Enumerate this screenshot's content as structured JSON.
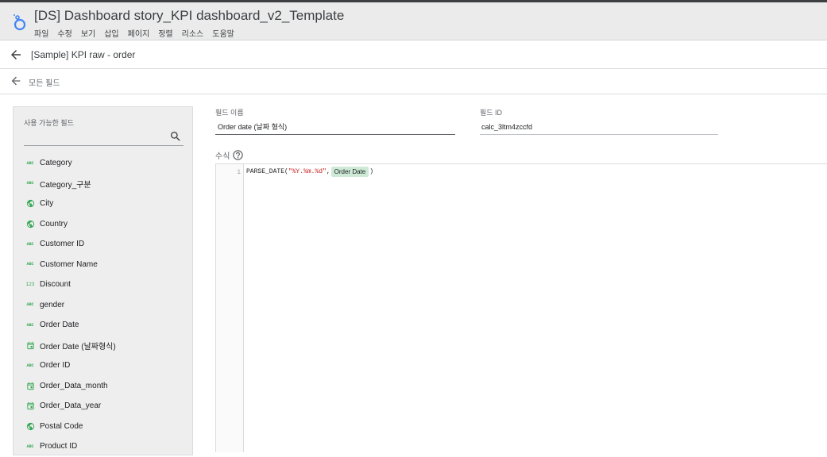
{
  "app": {
    "title": "[DS] Dashboard story_KPI dashboard_v2_Template",
    "menu": [
      "파일",
      "수정",
      "보기",
      "삽입",
      "페이지",
      "정렬",
      "리소스",
      "도움말"
    ],
    "more_dots": "....",
    "logo_icon": "looker-studio-logo-icon"
  },
  "datasource": {
    "name": "[Sample] KPI raw - order"
  },
  "nav": {
    "all_fields": "모든 필드"
  },
  "panel": {
    "label": "사용 가능한 필드",
    "search_placeholder": "",
    "fields": [
      {
        "name": "Category",
        "type": "text",
        "badge": "ABC"
      },
      {
        "name": "Category_구분",
        "type": "text",
        "badge": "ABC"
      },
      {
        "name": "City",
        "type": "geo",
        "badge": ""
      },
      {
        "name": "Country",
        "type": "geo",
        "badge": ""
      },
      {
        "name": "Customer ID",
        "type": "text",
        "badge": "ABC"
      },
      {
        "name": "Customer Name",
        "type": "text",
        "badge": "ABC"
      },
      {
        "name": "Discount",
        "type": "number",
        "badge": "123"
      },
      {
        "name": "gender",
        "type": "text",
        "badge": "ABC"
      },
      {
        "name": "Order Date",
        "type": "text",
        "badge": "ABC"
      },
      {
        "name": "Order Date (날짜형식)",
        "type": "date",
        "badge": ""
      },
      {
        "name": "Order ID",
        "type": "text",
        "badge": "ABC"
      },
      {
        "name": "Order_Data_month",
        "type": "date",
        "badge": ""
      },
      {
        "name": "Order_Data_year",
        "type": "date",
        "badge": ""
      },
      {
        "name": "Postal Code",
        "type": "geo",
        "badge": ""
      },
      {
        "name": "Product ID",
        "type": "text",
        "badge": "ABC"
      }
    ]
  },
  "form": {
    "field_name_label": "필드 이름",
    "field_name_value": "Order date (날짜 형식)",
    "field_id_label": "필드 ID",
    "field_id_value": "calc_3ltm4zccfd",
    "formula_label": "수식"
  },
  "editor": {
    "line_number": "1",
    "func": "PARSE_DATE(",
    "string_arg": "\"%Y.%m.%d\"",
    "comma": ",",
    "field_chip": "Order Date",
    "close": ")"
  },
  "colors": {
    "accent": "#4285f4",
    "type_icon": "#34a853",
    "chip_bg": "#ceead6",
    "string": "#c5221f"
  }
}
